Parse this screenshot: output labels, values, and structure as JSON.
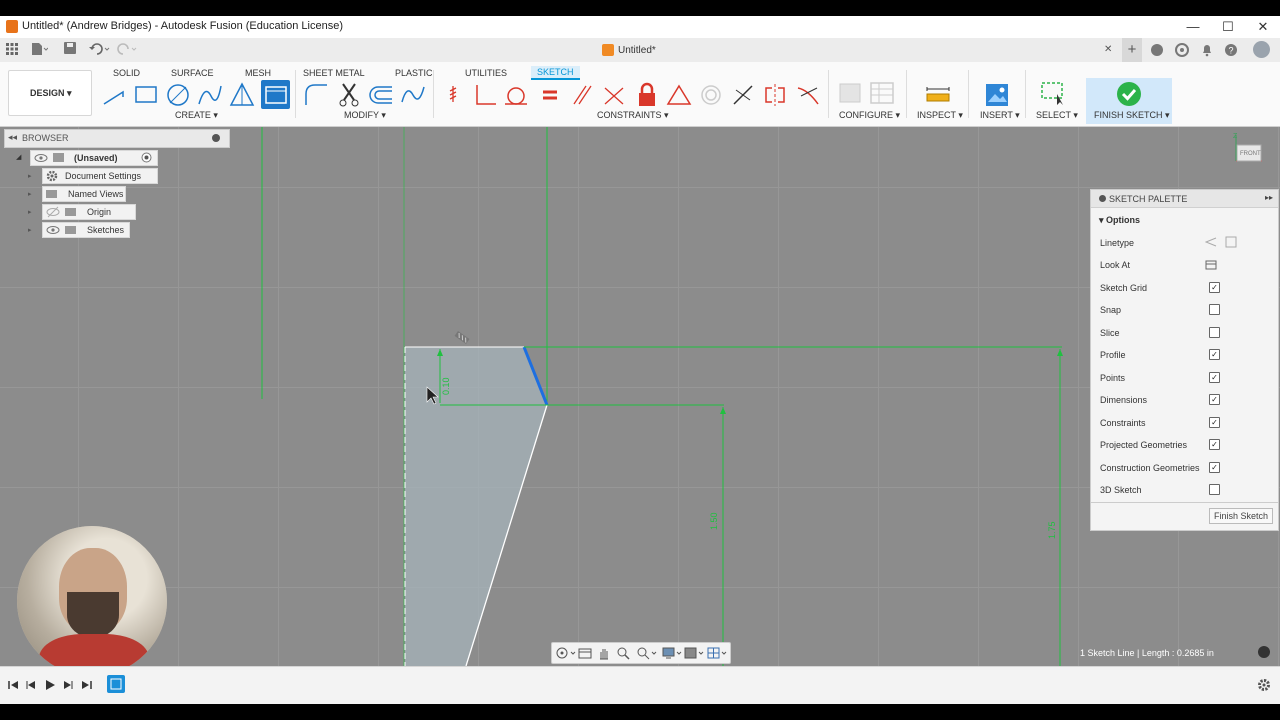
{
  "window": {
    "title": "Untitled* (Andrew Bridges) - Autodesk Fusion (Education License)",
    "minimize": "—",
    "maximize": "☐",
    "close": "✕"
  },
  "tabbar": {
    "doc_tab": "Untitled*",
    "close": "✕",
    "add": "+"
  },
  "workspace": {
    "label": "DESIGN ▾"
  },
  "ribbon_tabs": [
    "SOLID",
    "SURFACE",
    "MESH",
    "SHEET METAL",
    "PLASTIC",
    "UTILITIES",
    "SKETCH"
  ],
  "active_tab": "SKETCH",
  "groups": {
    "create": "CREATE ▾",
    "modify": "MODIFY ▾",
    "constraints": "CONSTRAINTS ▾",
    "configure": "CONFIGURE ▾",
    "inspect": "INSPECT ▾",
    "insert": "INSERT ▾",
    "select": "SELECT ▾",
    "finish": "FINISH SKETCH ▾"
  },
  "browser": {
    "title": "BROWSER",
    "root": "(Unsaved)",
    "items": [
      "Document Settings",
      "Named Views",
      "Origin",
      "Sketches"
    ]
  },
  "viewcube": {
    "face": "FRONT",
    "axis": "Z"
  },
  "sketch": {
    "dim_small": "0.10",
    "dim_150": "1.50",
    "dim_175": "1.75"
  },
  "palette": {
    "title": "SKETCH PALETTE",
    "section": "Options",
    "rows": [
      {
        "label": "Linetype",
        "kind": "icons"
      },
      {
        "label": "Look At",
        "kind": "icon"
      },
      {
        "label": "Sketch Grid",
        "checked": true
      },
      {
        "label": "Snap",
        "checked": false
      },
      {
        "label": "Slice",
        "checked": false
      },
      {
        "label": "Profile",
        "checked": true
      },
      {
        "label": "Points",
        "checked": true
      },
      {
        "label": "Dimensions",
        "checked": true
      },
      {
        "label": "Constraints",
        "checked": true
      },
      {
        "label": "Projected Geometries",
        "checked": true
      },
      {
        "label": "Construction Geometries",
        "checked": true
      },
      {
        "label": "3D Sketch",
        "checked": false
      }
    ],
    "finish_button": "Finish Sketch"
  },
  "status": {
    "text": "1 Sketch Line | Length : 0.2685 in"
  },
  "colors": {
    "accent": "#0696d7",
    "finish_green": "#2cb34a",
    "sketch_green": "#20c040",
    "selected_line": "#1e6fe0",
    "viewport": "#8c8c8c"
  }
}
